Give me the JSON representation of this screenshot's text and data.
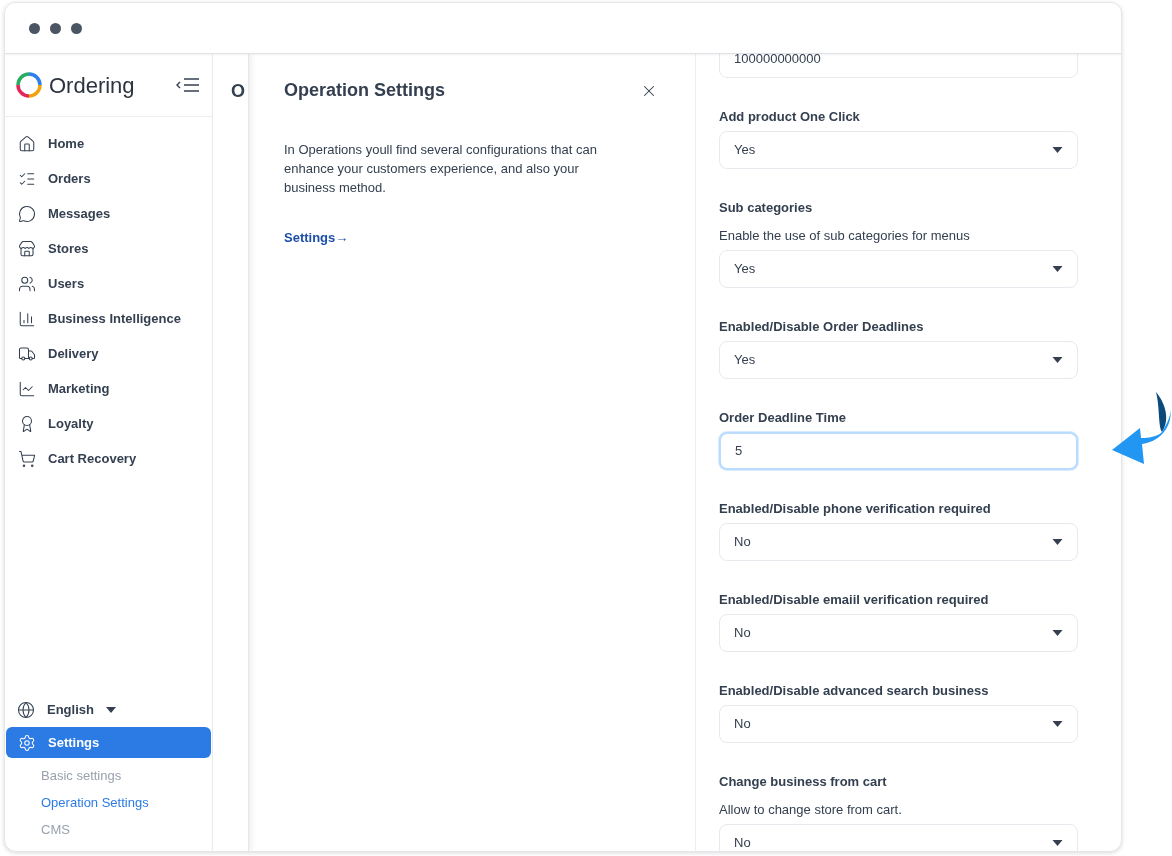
{
  "brand": {
    "name": "Ordering"
  },
  "sidebar": {
    "items": [
      {
        "label": "Home",
        "selected": false
      },
      {
        "label": "Orders",
        "selected": false
      },
      {
        "label": "Messages",
        "selected": false
      },
      {
        "label": "Stores",
        "selected": false
      },
      {
        "label": "Users",
        "selected": false
      },
      {
        "label": "Business Intelligence",
        "selected": false
      },
      {
        "label": "Delivery",
        "selected": false
      },
      {
        "label": "Marketing",
        "selected": false
      },
      {
        "label": "Loyalty",
        "selected": false
      },
      {
        "label": "Cart Recovery",
        "selected": false
      }
    ],
    "language": "English",
    "settings": {
      "label": "Settings",
      "selected": true,
      "children": [
        {
          "label": "Basic settings",
          "selected": false
        },
        {
          "label": "Operation Settings",
          "selected": true
        },
        {
          "label": "CMS",
          "selected": false
        }
      ]
    }
  },
  "background_page": {
    "title_fragment": "O"
  },
  "drawer": {
    "title": "Operation Settings",
    "description": "In Operations youll find several configurations that can enhance your customers experience, and also your business method.",
    "link": "Settings→"
  },
  "form": {
    "fields": [
      {
        "kind": "input",
        "value": "100000000000",
        "focused": false
      },
      {
        "kind": "select",
        "label": "Add product One Click",
        "value": "Yes",
        "focused": false
      },
      {
        "kind": "select",
        "label": "Sub categories",
        "description": "Enable the use of sub categories for menus",
        "value": "Yes",
        "focused": false
      },
      {
        "kind": "select",
        "label": "Enabled/Disable Order Deadlines",
        "value": "Yes",
        "focused": false
      },
      {
        "kind": "input",
        "label": "Order Deadline Time",
        "value": "5",
        "focused": true
      },
      {
        "kind": "select",
        "label": "Enabled/Disable phone verification required",
        "value": "No",
        "focused": false
      },
      {
        "kind": "select",
        "label": "Enabled/Disable emaiil verification required",
        "value": "No",
        "focused": false
      },
      {
        "kind": "select",
        "label": "Enabled/Disable advanced search business",
        "value": "No",
        "focused": false
      },
      {
        "kind": "select",
        "label": "Change business from cart",
        "description": "Allow to change store from cart.",
        "value": "No",
        "focused": false
      }
    ]
  }
}
